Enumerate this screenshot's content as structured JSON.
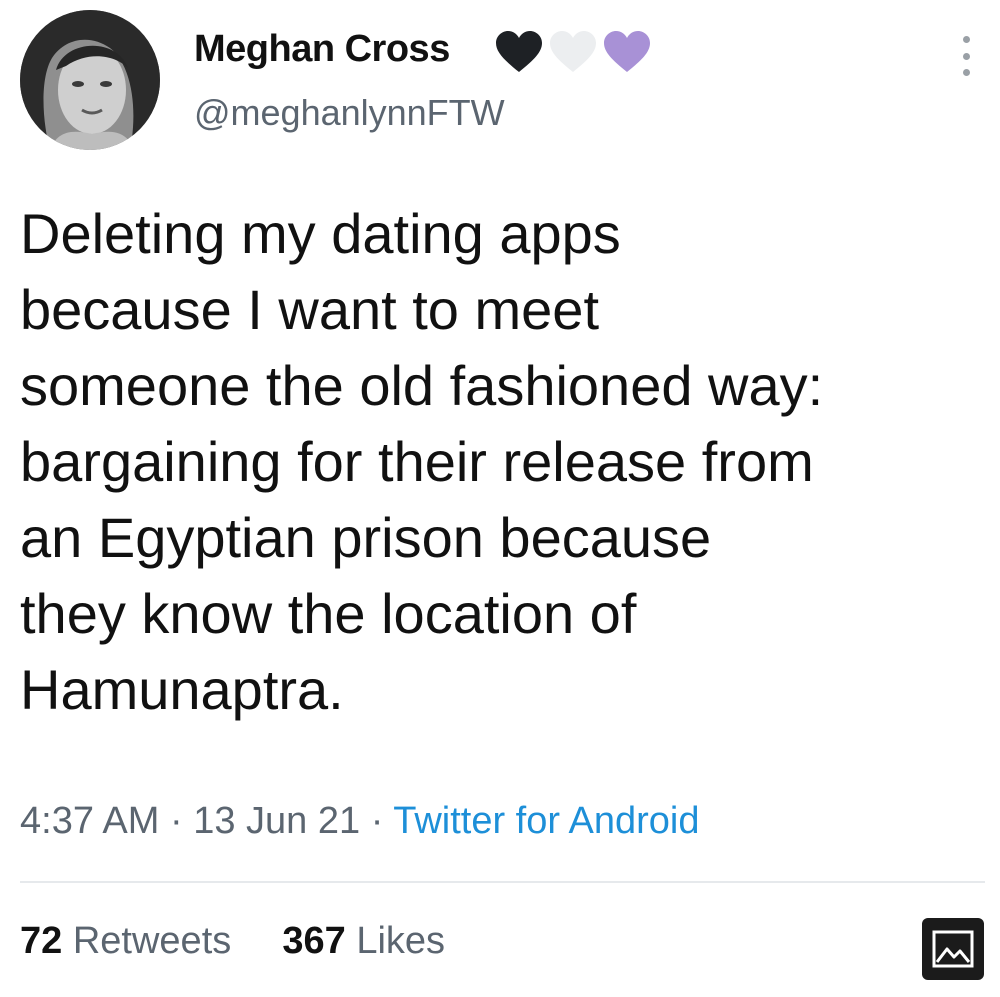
{
  "author": {
    "display_name": "Meghan Cross",
    "handle": "@meghanlynnFTW",
    "name_emoji": [
      "black-heart",
      "white-heart",
      "purple-heart"
    ]
  },
  "tweet": {
    "lines": [
      "Deleting my dating apps",
      "because I want to meet",
      "someone the old fashioned way:",
      "bargaining for their release from",
      "an Egyptian prison because",
      "they know the location of",
      "Hamunaptra."
    ]
  },
  "meta": {
    "time": "4:37 AM",
    "separator": "·",
    "date": "13 Jun 21",
    "source": "Twitter for Android"
  },
  "stats": {
    "retweets_count": "72",
    "retweets_label": "Retweets",
    "likes_count": "367",
    "likes_label": "Likes"
  },
  "colors": {
    "text": "#111111",
    "secondary": "#5b6570",
    "link": "#1d8fd8",
    "divider": "#e6e9ec",
    "black_heart": "#1e2125",
    "white_heart": "#eceef0",
    "purple_heart": "#a891d6"
  },
  "icons": {
    "more": "more-vertical-icon",
    "image": "image-icon"
  }
}
